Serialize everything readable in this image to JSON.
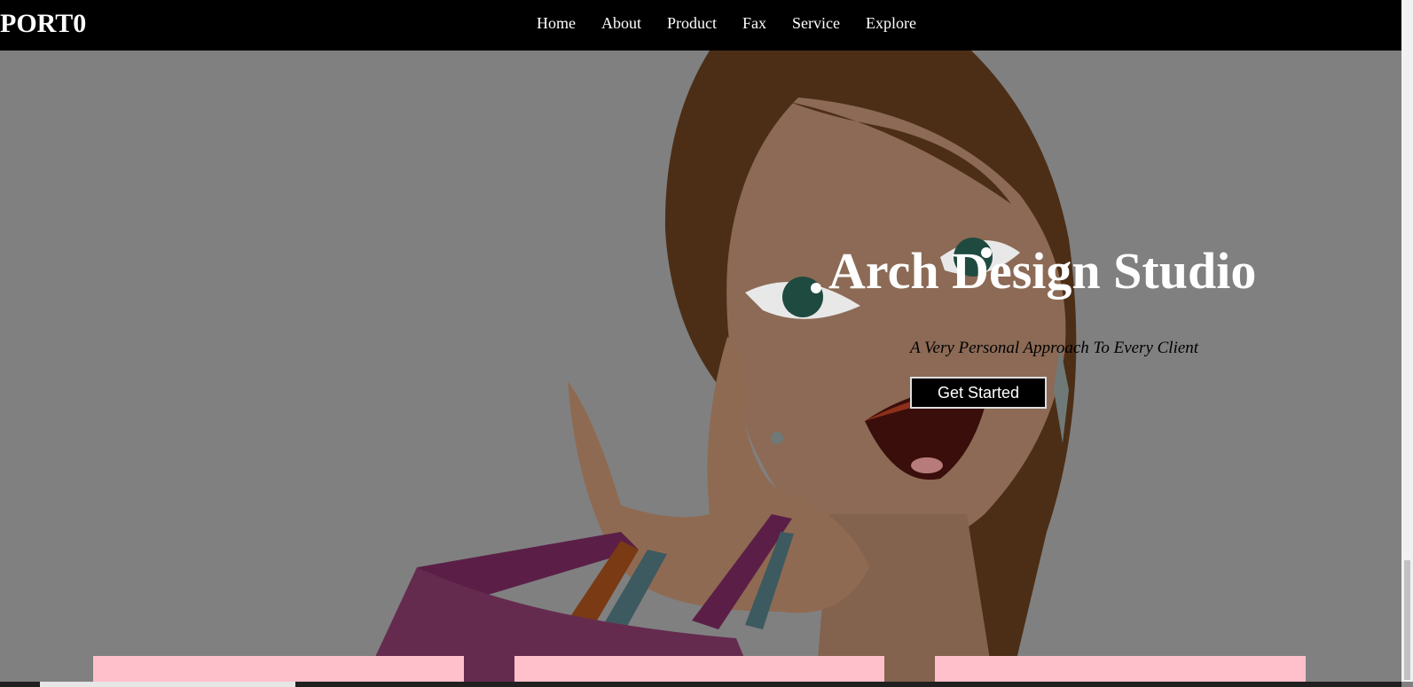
{
  "brand": "PORT0",
  "nav": {
    "items": [
      "Home",
      "About",
      "Product",
      "Fax",
      "Service",
      "Explore"
    ]
  },
  "hero": {
    "title": "Arch Design Studio",
    "tagline": "A Very Personal Approach To Every Client",
    "cta_label": "Get Started",
    "illustration": "cartoon-woman-with-shopping-bags"
  },
  "colors": {
    "navbar": "#000000",
    "overlay": "#808080",
    "card": "#ffc0cb",
    "title": "#ffffff"
  }
}
